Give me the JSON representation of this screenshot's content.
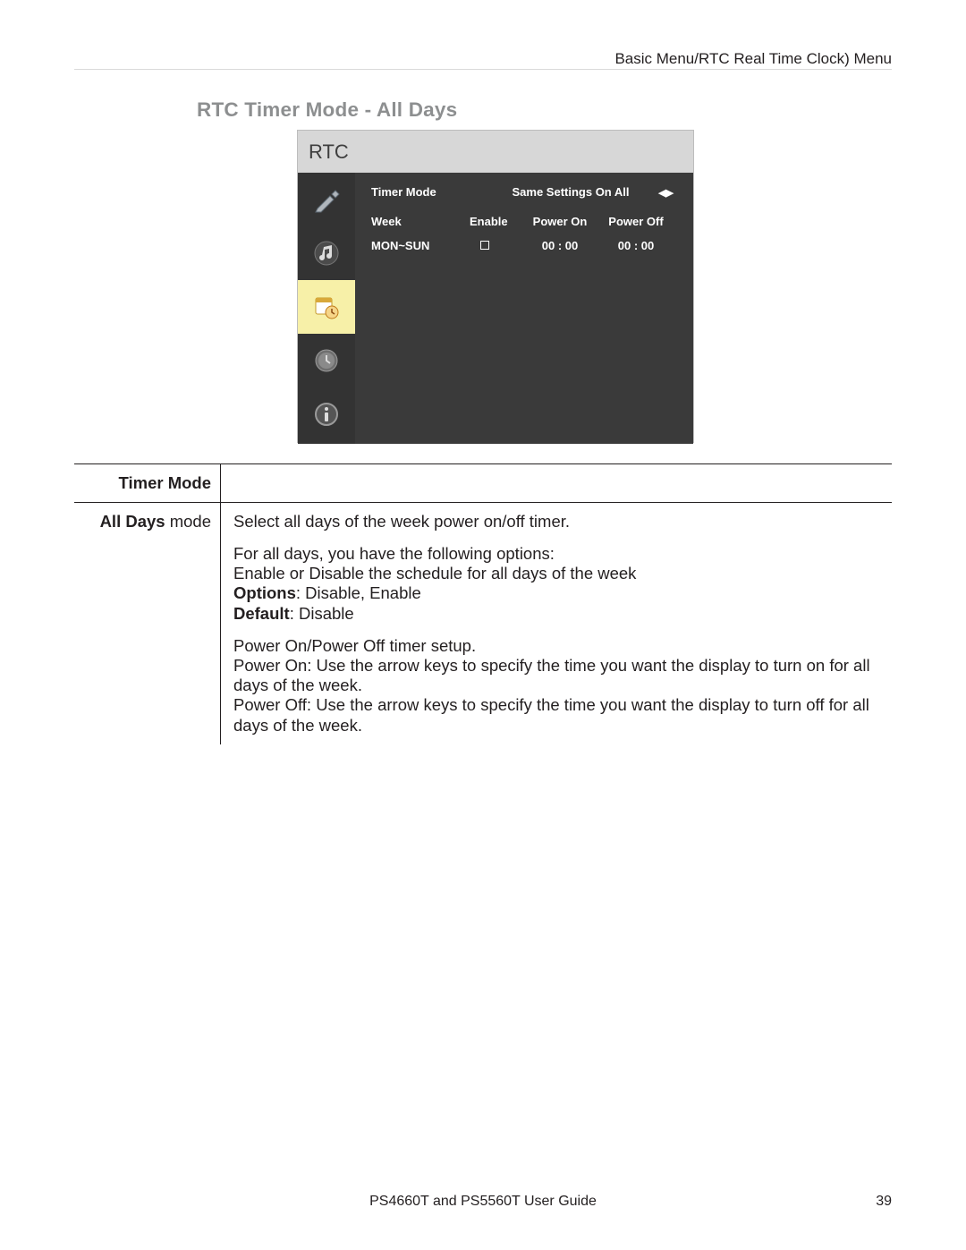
{
  "breadcrumb": "Basic Menu/RTC Real Time Clock) Menu",
  "section_title": "RTC Timer Mode - All Days",
  "osd": {
    "title": "RTC",
    "timer_mode_label": "Timer Mode",
    "timer_mode_value": "Same Settings On All",
    "col_week": "Week",
    "col_enable": "Enable",
    "col_power_on": "Power On",
    "col_power_off": "Power Off",
    "row_week": "MON~SUN",
    "row_power_on": "00  :  00",
    "row_power_off": "00  :  00",
    "nav_icons": [
      "brush-icon",
      "music-icon",
      "calendar-clock-icon",
      "clock-icon",
      "info-icon"
    ]
  },
  "table": {
    "header_left": "Timer Mode",
    "row_label_bold": "All Days",
    "row_label_rest": " mode",
    "p1": "Select all days of the week power on/off timer.",
    "p2_l1": "For all days, you have the following options:",
    "p2_l2": "Enable or Disable the schedule for all days of the week",
    "p2_options_label": "Options",
    "p2_options_values": ": Disable, Enable",
    "p2_default_label": "Default",
    "p2_default_value": ": Disable",
    "p3_l1": "Power On/Power Off timer setup.",
    "p3_l2": "Power On: Use the arrow keys to specify the time you want the display to turn on for all days of the week.",
    "p3_l3": "Power Off: Use the arrow keys to specify the time you want the display to turn off for all days of the week."
  },
  "footer": "PS4660T and PS5560T User Guide",
  "page_number": "39"
}
